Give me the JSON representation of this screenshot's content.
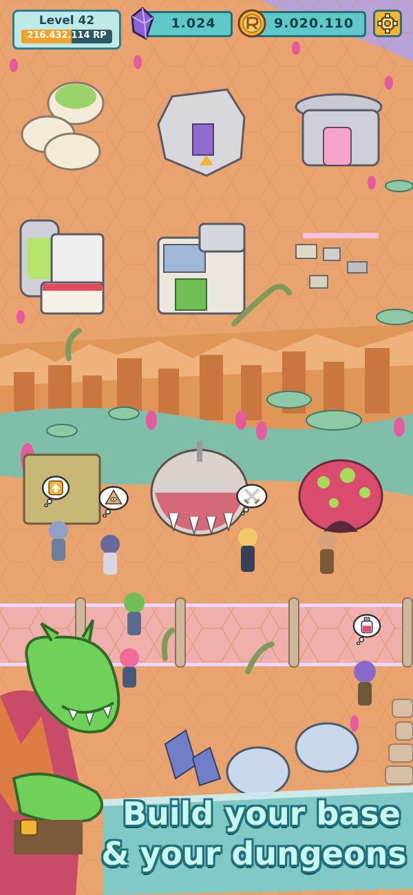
{
  "hud": {
    "level_label": "Level 42",
    "research_points": "216.432.114 RP",
    "research_progress": 0.55,
    "gems": "1.024",
    "coins": "9.020.110",
    "settings_icon": "gear-icon",
    "gem_icon": "purple-crystal-icon",
    "coin_icon": "gold-coin-icon"
  },
  "banner": {
    "line1": "Build your base",
    "line2": "& your dungeons"
  },
  "thought_bubbles": [
    {
      "icon": "upgrade-arrow-icon"
    },
    {
      "icon": "pyramid-eye-icon"
    },
    {
      "icon": "crossed-swords-icon"
    },
    {
      "icon": "potion-bottle-icon"
    }
  ],
  "colors": {
    "ground": "#e8a36e",
    "grass": "#7fbfa9",
    "panel_teal": "#5fc8c8",
    "panel_border": "#246f79",
    "banner_text": "#c9f6ee",
    "banner_outline": "#20707a",
    "alien_green": "#6fd05a"
  }
}
